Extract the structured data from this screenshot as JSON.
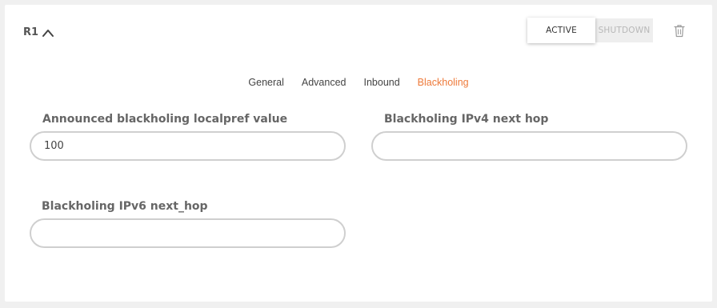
{
  "router": {
    "name": "R1"
  },
  "state": {
    "active_label": "ACTIVE",
    "shutdown_label": "SHUTDOWN",
    "selected": "active"
  },
  "tabs": [
    {
      "label": "General",
      "active": false
    },
    {
      "label": "Advanced",
      "active": false
    },
    {
      "label": "Inbound",
      "active": false
    },
    {
      "label": "Blackholing",
      "active": true
    }
  ],
  "fields": {
    "localpref": {
      "label": "Announced blackholing localpref value",
      "value": "100",
      "placeholder": ""
    },
    "ipv4_next_hop": {
      "label": "Blackholing IPv4 next hop",
      "value": "",
      "placeholder": ""
    },
    "ipv6_next_hop": {
      "label": "Blackholing IPv6 next_hop",
      "value": "",
      "placeholder": ""
    }
  },
  "icons": {
    "collapse": "chevron-up-icon",
    "delete": "trash-icon"
  },
  "colors": {
    "accent": "#ee7a3a",
    "background": "#f0f0f0",
    "card": "#ffffff",
    "input_border": "#cfcfcf"
  }
}
